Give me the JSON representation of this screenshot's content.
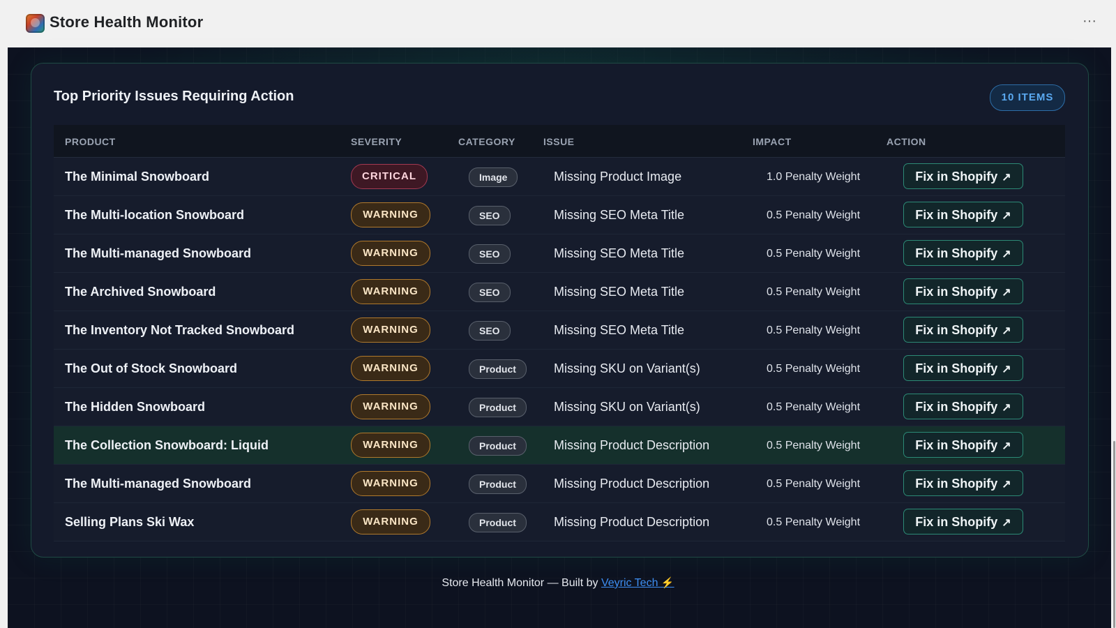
{
  "app": {
    "title": "Store Health Monitor",
    "menu_icon": "more-horizontal-icon",
    "more_glyph": "···"
  },
  "card": {
    "title": "Top Priority Issues Requiring Action",
    "count_badge": "10 ITEMS"
  },
  "table": {
    "headers": {
      "product": "PRODUCT",
      "severity": "SEVERITY",
      "category": "CATEGORY",
      "issue": "ISSUE",
      "impact": "IMPACT",
      "action": "ACTION"
    },
    "rows": [
      {
        "product": "The Minimal Snowboard",
        "severity": "CRITICAL",
        "category": "Image",
        "issue": "Missing Product Image",
        "impact": "1.0 Penalty Weight",
        "action": "Fix in Shopify"
      },
      {
        "product": "The Multi-location Snowboard",
        "severity": "WARNING",
        "category": "SEO",
        "issue": "Missing SEO Meta Title",
        "impact": "0.5 Penalty Weight",
        "action": "Fix in Shopify"
      },
      {
        "product": "The Multi-managed Snowboard",
        "severity": "WARNING",
        "category": "SEO",
        "issue": "Missing SEO Meta Title",
        "impact": "0.5 Penalty Weight",
        "action": "Fix in Shopify"
      },
      {
        "product": "The Archived Snowboard",
        "severity": "WARNING",
        "category": "SEO",
        "issue": "Missing SEO Meta Title",
        "impact": "0.5 Penalty Weight",
        "action": "Fix in Shopify"
      },
      {
        "product": "The Inventory Not Tracked Snowboard",
        "severity": "WARNING",
        "category": "SEO",
        "issue": "Missing SEO Meta Title",
        "impact": "0.5 Penalty Weight",
        "action": "Fix in Shopify"
      },
      {
        "product": "The Out of Stock Snowboard",
        "severity": "WARNING",
        "category": "Product",
        "issue": "Missing SKU on Variant(s)",
        "impact": "0.5 Penalty Weight",
        "action": "Fix in Shopify"
      },
      {
        "product": "The Hidden Snowboard",
        "severity": "WARNING",
        "category": "Product",
        "issue": "Missing SKU on Variant(s)",
        "impact": "0.5 Penalty Weight",
        "action": "Fix in Shopify"
      },
      {
        "product": "The Collection Snowboard: Liquid",
        "severity": "WARNING",
        "category": "Product",
        "issue": "Missing Product Description",
        "impact": "0.5 Penalty Weight",
        "action": "Fix in Shopify"
      },
      {
        "product": "The Multi-managed Snowboard",
        "severity": "WARNING",
        "category": "Product",
        "issue": "Missing Product Description",
        "impact": "0.5 Penalty Weight",
        "action": "Fix in Shopify"
      },
      {
        "product": "Selling Plans Ski Wax",
        "severity": "WARNING",
        "category": "Product",
        "issue": "Missing Product Description",
        "impact": "0.5 Penalty Weight",
        "action": "Fix in Shopify"
      }
    ]
  },
  "footer": {
    "text": "Store Health Monitor — Built by",
    "link": "Veyric Tech",
    "bolt": "⚡"
  },
  "colors": {
    "background": "#0d1220",
    "card": "#141a2b",
    "critical": "#a43a52",
    "warning": "#b17a2c",
    "accent": "#2c8a76",
    "link": "#3d8ef2"
  }
}
